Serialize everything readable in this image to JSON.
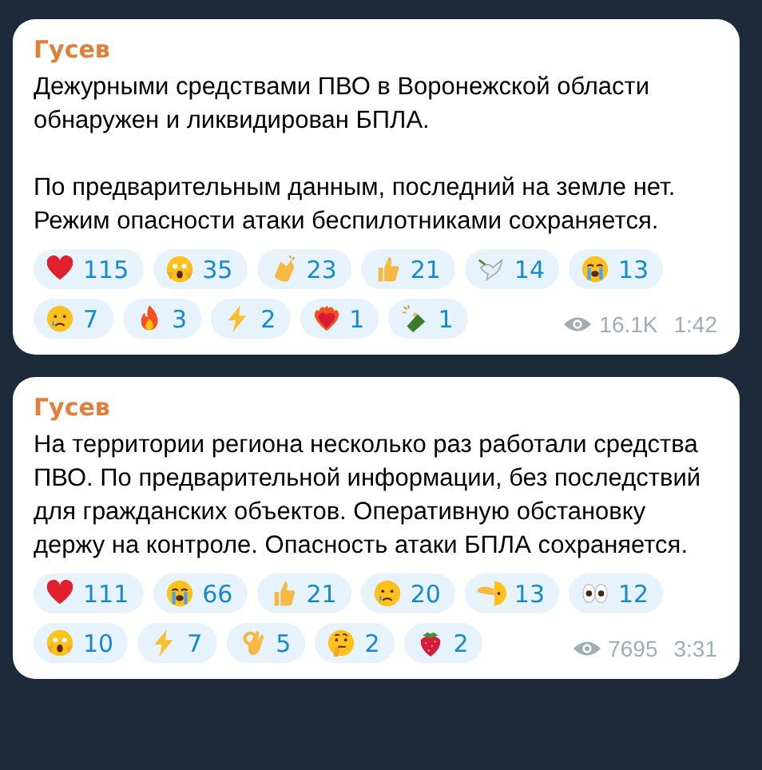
{
  "messages": [
    {
      "author": "Гусев",
      "paragraphs": [
        "Дежурными средствами ПВО в Воронежской области обнаружен и ликвидирован БПЛА.",
        "По предварительным данным, последний на земле нет. Режим опасности атаки беспилотниками сохраняется."
      ],
      "reactions": [
        {
          "kind": "heart",
          "count": "115"
        },
        {
          "kind": "scream",
          "count": "35"
        },
        {
          "kind": "clap",
          "count": "23"
        },
        {
          "kind": "thumbs",
          "count": "21"
        },
        {
          "kind": "dove",
          "count": "14"
        },
        {
          "kind": "sob",
          "count": "13"
        },
        {
          "kind": "cry",
          "count": "7"
        },
        {
          "kind": "fire",
          "count": "3"
        },
        {
          "kind": "zap",
          "count": "2"
        },
        {
          "kind": "fireheart",
          "count": "1"
        },
        {
          "kind": "bottle",
          "count": "1"
        }
      ],
      "views": "16.1K",
      "time": "1:42"
    },
    {
      "author": "Гусев",
      "paragraphs": [
        "На территории региона несколько раз работали средства ПВО. По предварительной информации, без последствий для гражданских объектов. Оперативную обстановку держу на контроле. Опасность атаки БПЛА сохраняется."
      ],
      "reactions": [
        {
          "kind": "heart",
          "count": "111"
        },
        {
          "kind": "sob",
          "count": "66"
        },
        {
          "kind": "thumbs",
          "count": "21"
        },
        {
          "kind": "cry",
          "count": "20"
        },
        {
          "kind": "point",
          "count": "13"
        },
        {
          "kind": "eyes",
          "count": "12"
        },
        {
          "kind": "scream",
          "count": "10"
        },
        {
          "kind": "zap",
          "count": "7"
        },
        {
          "kind": "ok",
          "count": "5"
        },
        {
          "kind": "think",
          "count": "2"
        },
        {
          "kind": "strawberry",
          "count": "2"
        }
      ],
      "views": "7695",
      "time": "3:31"
    }
  ]
}
